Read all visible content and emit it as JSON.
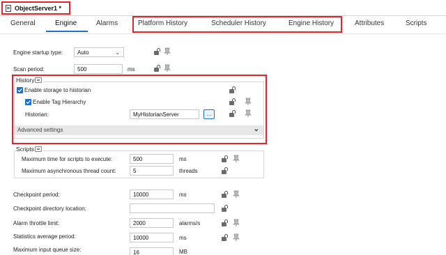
{
  "window": {
    "title": "ObjectServer1 *"
  },
  "tabs": [
    {
      "label": "General"
    },
    {
      "label": "Engine"
    },
    {
      "label": "Alarms"
    },
    {
      "label": "Platform History"
    },
    {
      "label": "Scheduler History"
    },
    {
      "label": "Engine History"
    },
    {
      "label": "Attributes"
    },
    {
      "label": "Scripts"
    }
  ],
  "active_tab": "Engine",
  "engine": {
    "startup_type_label": "Engine startup type:",
    "startup_type_value": "Auto",
    "scan_period_label": "Scan period:",
    "scan_period_value": "500",
    "scan_period_unit": "ms"
  },
  "history": {
    "group_title": "History",
    "enable_storage_label": "Enable storage to historian",
    "enable_storage_checked": true,
    "enable_tag_hierarchy_label": "Enable Tag Hierarchy",
    "enable_tag_hierarchy_checked": true,
    "historian_label": "Historian:",
    "historian_value": "MyHistorianServer",
    "browse_label": "...",
    "advanced_label": "Advanced settings"
  },
  "scripts": {
    "group_title": "Scripts",
    "max_time_label": "Maximum time for scripts to execute:",
    "max_time_value": "500",
    "max_time_unit": "ms",
    "max_threads_label": "Maximum asynchronous thread count:",
    "max_threads_value": "5",
    "max_threads_unit": "threads"
  },
  "more": {
    "checkpoint_period_label": "Checkpoint period:",
    "checkpoint_period_value": "10000",
    "checkpoint_period_unit": "ms",
    "checkpoint_dir_label": "Checkpoint directory location:",
    "checkpoint_dir_value": "",
    "alarm_throttle_label": "Alarm throttle limit:",
    "alarm_throttle_value": "2000",
    "alarm_throttle_unit": "alarms/s",
    "stats_period_label": "Statistics average period:",
    "stats_period_value": "10000",
    "stats_period_unit": "ms",
    "max_queue_label": "Maximum input queue size:",
    "max_queue_value": "16",
    "max_queue_unit": "MB"
  },
  "colors": {
    "accent": "#1f6fce",
    "highlight": "#e8212a"
  }
}
